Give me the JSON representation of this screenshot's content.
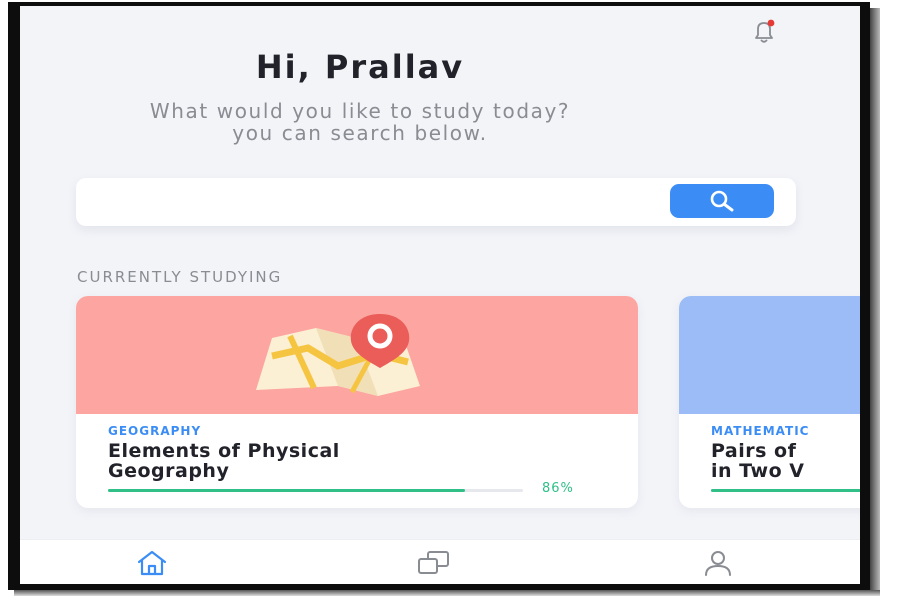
{
  "header": {
    "greeting": "Hi, Prallav",
    "subtitle_line1": "What would you like to study today?",
    "subtitle_line2": "you can search below.",
    "notification_icon": "bell-icon",
    "notification_badge_color": "#e53935"
  },
  "search": {
    "placeholder": "",
    "value": "",
    "button_icon": "search-icon",
    "button_color": "#3b8df5"
  },
  "currently_studying": {
    "title": "CURRENTLY STUDYING",
    "courses": [
      {
        "subject": "GEOGRAPHY",
        "title_line1": "Elements of Physical",
        "title_line2": "Geography",
        "progress": 86,
        "progress_label": "86%",
        "color": "#fda5a0",
        "icon": "map-pin-icon"
      },
      {
        "subject": "MATHEMATIC",
        "title_line1": "Pairs of",
        "title_line2": "in Two V",
        "color": "#9cbcf7"
      }
    ]
  },
  "bottom_nav": {
    "items": [
      {
        "icon": "home-icon",
        "active": true
      },
      {
        "icon": "courses-icon",
        "active": false
      },
      {
        "icon": "profile-icon",
        "active": false
      }
    ],
    "active_color": "#3b8df5",
    "inactive_color": "#8a8c93"
  }
}
